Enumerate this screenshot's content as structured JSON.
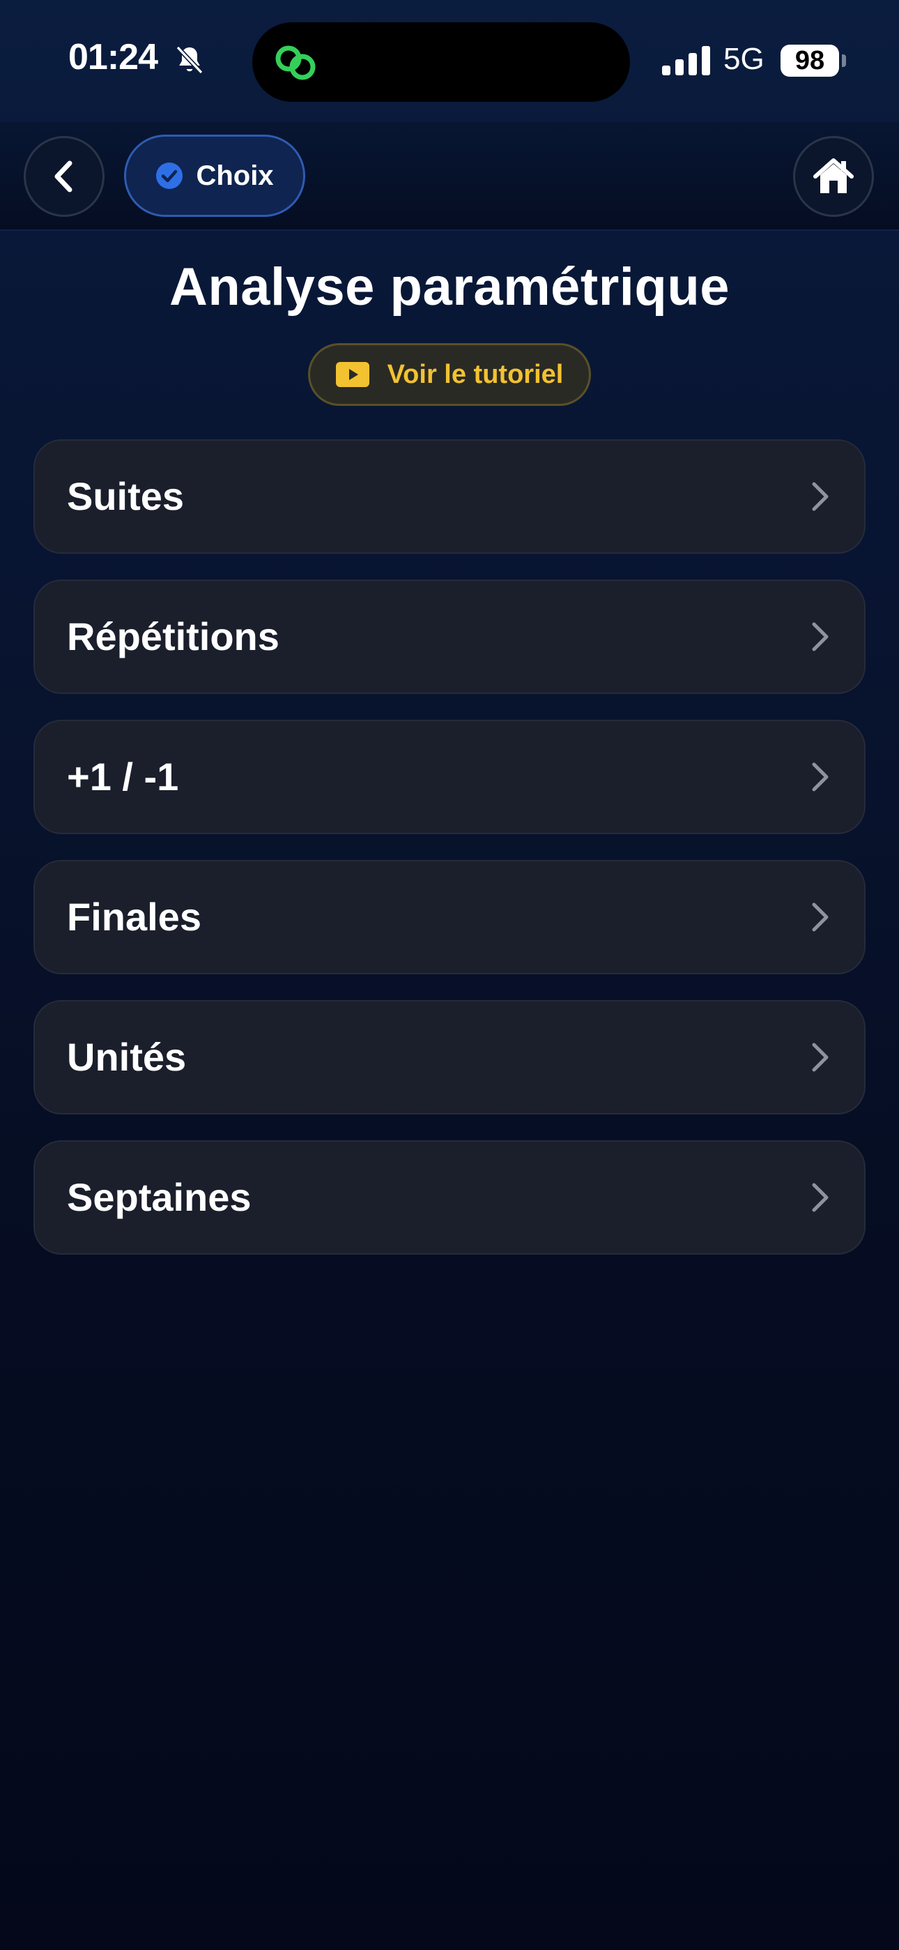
{
  "status_bar": {
    "time": "01:24",
    "network": "5G",
    "battery": "98"
  },
  "nav": {
    "choice_label": "Choix"
  },
  "page": {
    "title": "Analyse paramétrique",
    "tutorial_label": "Voir le tutoriel"
  },
  "menu": {
    "items": [
      {
        "label": "Suites"
      },
      {
        "label": "Répétitions"
      },
      {
        "label": "+1 / -1"
      },
      {
        "label": "Finales"
      },
      {
        "label": "Unités"
      },
      {
        "label": "Septaines"
      }
    ]
  },
  "colors": {
    "accent_blue": "#2f6fe6",
    "tutorial_yellow": "#f2c230",
    "link_green": "#34d05a",
    "card_bg": "#1b1f2c"
  },
  "icons": {
    "back": "chevron-left-icon",
    "home": "home-icon",
    "check": "check-circle-icon",
    "tutorial": "play-icon",
    "row": "chevron-right-icon",
    "silent": "bell-slash-icon",
    "island": "link-icon"
  }
}
